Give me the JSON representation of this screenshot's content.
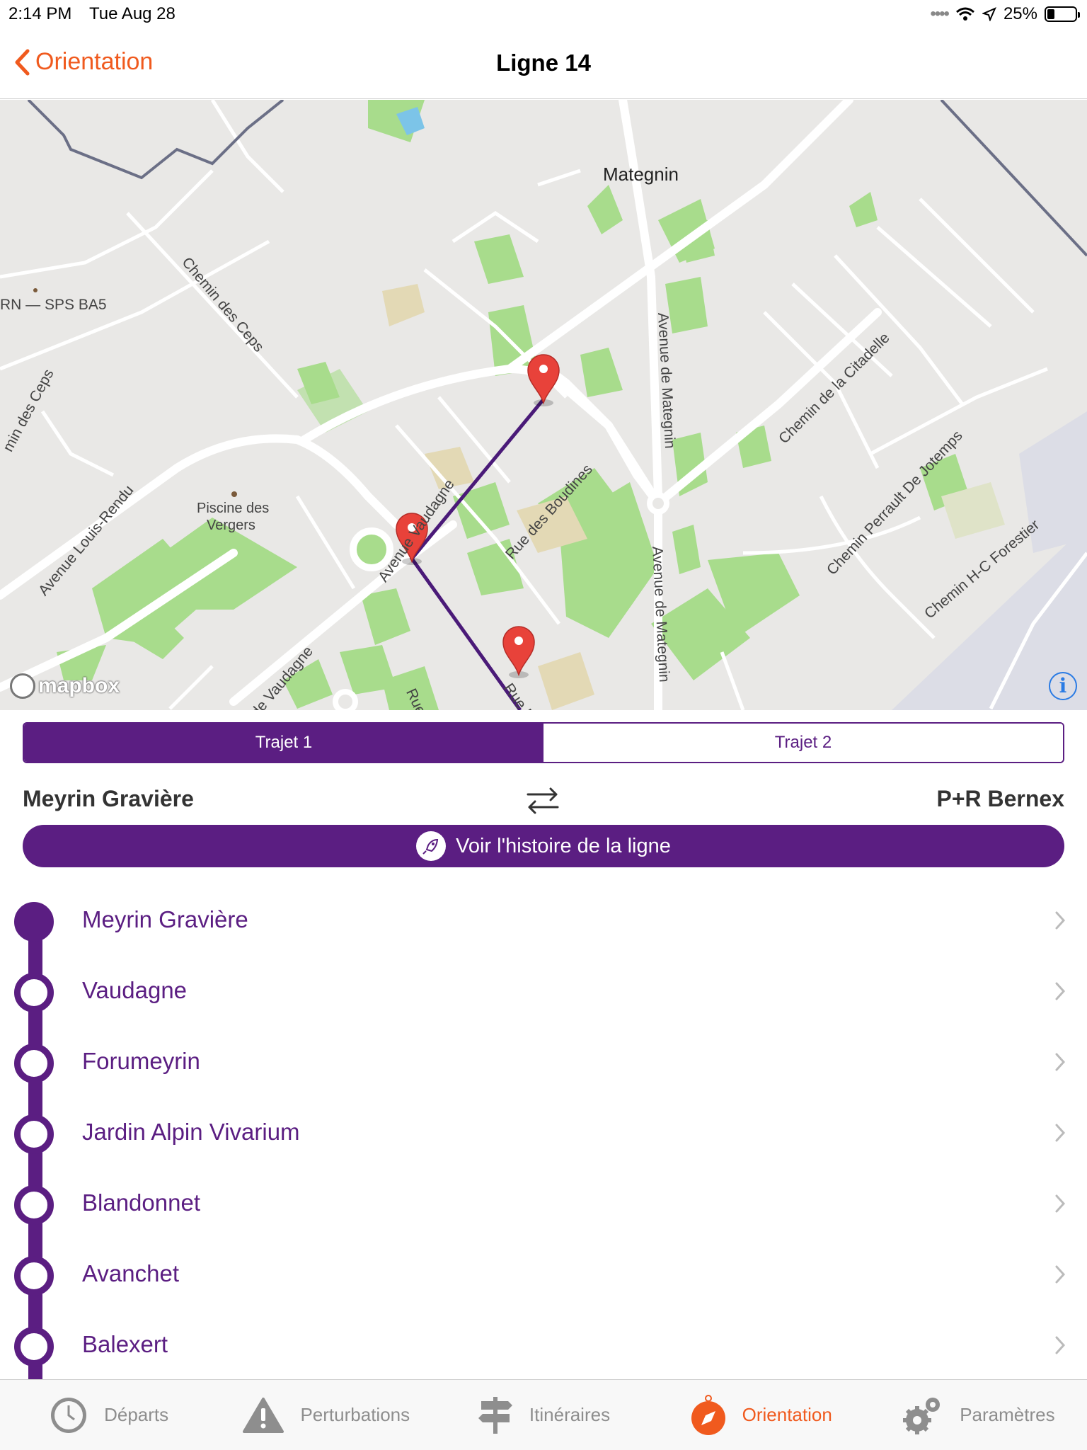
{
  "status_bar": {
    "time": "2:14 PM",
    "date": "Tue Aug 28",
    "battery": "25%"
  },
  "nav": {
    "back_label": "Orientation",
    "title": "Ligne 14"
  },
  "map": {
    "labels": {
      "mategnin": "Mategnin",
      "chemin_ceps": "Chemin des Ceps",
      "sps": "RN — SPS BA5",
      "chemin_ceps_left": "min des Ceps",
      "avenue_louis_rendu": "Avenue Louis-Rendu",
      "piscine_1": "Piscine des",
      "piscine_2": "Vergers",
      "avenue_vaudagne": "Avenue Vaudagne",
      "rue_boudines": "Rue des Boudines",
      "avenue_mategnin_top": "Avenue de Mategnin",
      "avenue_mategnin_bottom": "Avenue de Mategnin",
      "chemin_citadelle": "Chemin de la Citadelle",
      "chemin_perrault": "Chemin Perrault De Jotemps",
      "chemin_forestier": "Chemin H-C Forestier",
      "vaudagne_bottom": "de Vaudagne",
      "rue_bottom": "Rue",
      "rue_d": "Rue D"
    },
    "attribution": "mapbox",
    "info_icon": "info-icon",
    "route_color": "#4a1a78",
    "pin_color": "#e8423a"
  },
  "segments": {
    "trip1": "Trajet 1",
    "trip2": "Trajet 2"
  },
  "direction": {
    "from": "Meyrin Gravière",
    "to": "P+R Bernex"
  },
  "history_button": "Voir l'histoire de la ligne",
  "stops": [
    {
      "name": "Meyrin Gravière",
      "terminus": true
    },
    {
      "name": "Vaudagne"
    },
    {
      "name": "Forumeyrin"
    },
    {
      "name": "Jardin Alpin Vivarium"
    },
    {
      "name": "Blandonnet"
    },
    {
      "name": "Avanchet"
    },
    {
      "name": "Balexert"
    }
  ],
  "tabs": [
    {
      "label": "Départs",
      "icon": "clock-icon"
    },
    {
      "label": "Perturbations",
      "icon": "warning-icon"
    },
    {
      "label": "Itinéraires",
      "icon": "signpost-icon"
    },
    {
      "label": "Orientation",
      "icon": "compass-icon",
      "active": true
    },
    {
      "label": "Paramètres",
      "icon": "gear-icon"
    }
  ],
  "colors": {
    "accent": "#f05a1e",
    "line": "#5b1e82",
    "map_bg": "#e9e8e6",
    "park": "#a8dc8c"
  }
}
